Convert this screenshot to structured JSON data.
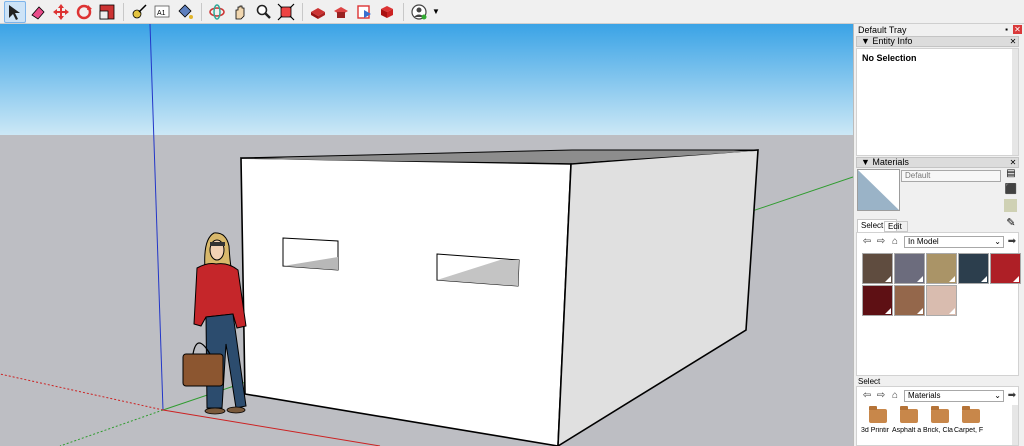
{
  "toolbar": {
    "tools": [
      {
        "icon": "select-arrow-icon",
        "active": true
      },
      {
        "icon": "eraser-icon"
      },
      {
        "icon": "move-icon"
      },
      {
        "icon": "rotate-icon"
      },
      {
        "icon": "scale-icon"
      },
      {
        "icon": "tape-measure-icon"
      },
      {
        "icon": "text-icon",
        "label": "A1"
      },
      {
        "icon": "paint-bucket-icon"
      },
      {
        "icon": "orbit-icon"
      },
      {
        "icon": "pan-icon"
      },
      {
        "icon": "zoom-icon"
      },
      {
        "icon": "zoom-extents-icon"
      },
      {
        "icon": "3d-warehouse-icon"
      },
      {
        "icon": "extension-warehouse-icon"
      },
      {
        "icon": "send-to-layout-icon"
      },
      {
        "icon": "extension-manager-icon"
      },
      {
        "icon": "account-icon"
      }
    ]
  },
  "colors": {
    "sky_top": "#3aa3e6",
    "sky_bottom": "#cce8f6",
    "ground": "#bdbec3",
    "tray_bg": "#f0f0f0",
    "accent": "#7eb4ea"
  },
  "tray": {
    "title": "Default Tray",
    "entity_info": {
      "header": "▼ Entity Info",
      "status": "No Selection"
    },
    "materials": {
      "header": "▼ Materials",
      "current_name": "Default",
      "tabs": [
        "Select",
        "Edit"
      ],
      "collection": "In Model",
      "swatches": [
        "#5f4c3f",
        "#6c6c7d",
        "#aa9467",
        "#2c3e4d",
        "#ae1f26",
        "#5e1014",
        "#94674b",
        "#d9bcaf"
      ]
    },
    "library": {
      "label": "Select",
      "collection": "Materials",
      "items": [
        "3d Printir",
        "Asphalt a",
        "Brick, Cla",
        "Carpet, F"
      ]
    }
  }
}
